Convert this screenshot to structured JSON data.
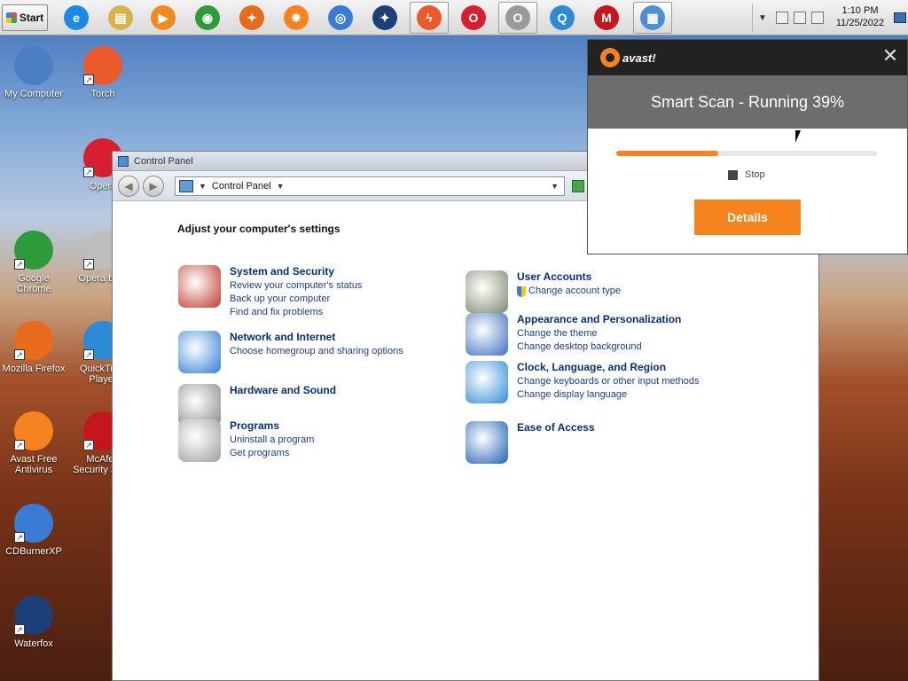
{
  "taskbar": {
    "start_label": "Start",
    "pinned": [
      {
        "name": "ie-icon",
        "color": "#1e88e5",
        "glyph": "e"
      },
      {
        "name": "explorer-icon",
        "color": "#d8b24a",
        "glyph": "▤"
      },
      {
        "name": "media-player-icon",
        "color": "#ef8a1f",
        "glyph": "▶"
      },
      {
        "name": "chrome-icon",
        "color": "#2e9b3b",
        "glyph": "◉"
      },
      {
        "name": "firefox-icon",
        "color": "#e86a1c",
        "glyph": "✦"
      },
      {
        "name": "avast-icon",
        "color": "#f7831f",
        "glyph": "✸"
      },
      {
        "name": "cdburner-icon",
        "color": "#3a7bd5",
        "glyph": "◎"
      },
      {
        "name": "waterfox-icon",
        "color": "#1d3f77",
        "glyph": "✦"
      },
      {
        "name": "torch-icon",
        "color": "#ea5a2a",
        "glyph": "ϟ"
      },
      {
        "name": "opera-icon",
        "color": "#d6202f",
        "glyph": "O"
      },
      {
        "name": "opera-beta-icon",
        "color": "#9a9a9a",
        "glyph": "O"
      },
      {
        "name": "quicktime-icon",
        "color": "#2d8ad6",
        "glyph": "Q"
      },
      {
        "name": "mcafee-icon",
        "color": "#c4161c",
        "glyph": "M"
      },
      {
        "name": "control-panel-icon",
        "color": "#4b8fd8",
        "glyph": "▦"
      }
    ],
    "tray": {
      "time": "1:10 PM",
      "date": "11/25/2022"
    }
  },
  "desktop": {
    "icons": [
      {
        "label": "My Computer",
        "color": "#4a7fc2"
      },
      {
        "label": "Torch",
        "color": "#ea5a2a"
      },
      {
        "label": "Opera",
        "color": "#d6202f"
      },
      {
        "label": "Google Chrome",
        "color": "#2e9b3b"
      },
      {
        "label": "Opera beta",
        "color": "#bdbdbd"
      },
      {
        "label": "Mozilla Firefox",
        "color": "#e86a1c"
      },
      {
        "label": "QuickTime Player",
        "color": "#2d8ad6"
      },
      {
        "label": "Avast Free Antivirus",
        "color": "#f7831f"
      },
      {
        "label": "McAfee Security Scan",
        "color": "#c4161c"
      },
      {
        "label": "CDBurnerXP",
        "color": "#3a7bd5"
      },
      {
        "label": "Waterfox",
        "color": "#1d3f77"
      }
    ]
  },
  "control_panel": {
    "title": "Control Panel",
    "address": "Control Panel",
    "heading": "Adjust your computer's settings",
    "categories_left": [
      {
        "title": "System and Security",
        "links": [
          "Review your computer's status",
          "Back up your computer",
          "Find and fix problems"
        ],
        "icon_color": "#c0392b"
      },
      {
        "title": "Network and Internet",
        "links": [
          "Choose homegroup and sharing options"
        ],
        "icon_color": "#2e7dd7"
      },
      {
        "title": "Hardware and Sound",
        "links": [],
        "icon_color": "#888888"
      },
      {
        "title": "Programs",
        "links": [
          "Uninstall a program",
          "Get programs"
        ],
        "icon_color": "#9e9e9e"
      }
    ],
    "categories_right": [
      {
        "title": "User Accounts",
        "links": [
          "Change account type"
        ],
        "icon_color": "#7a8a6a"
      },
      {
        "title": "Appearance and Personalization",
        "links": [
          "Change the theme",
          "Change desktop background"
        ],
        "icon_color": "#3b6fc1"
      },
      {
        "title": "Clock, Language, and Region",
        "links": [
          "Change keyboards or other input methods",
          "Change display language"
        ],
        "icon_color": "#2e8bd6"
      },
      {
        "title": "Ease of Access",
        "links": [],
        "icon_color": "#1f5fb4"
      }
    ]
  },
  "avast_popup": {
    "brand": "avast!",
    "status": "Smart Scan - Running  39%",
    "progress_percent": 39,
    "stop_label": "Stop",
    "details_label": "Details",
    "accent": "#f7831f"
  }
}
